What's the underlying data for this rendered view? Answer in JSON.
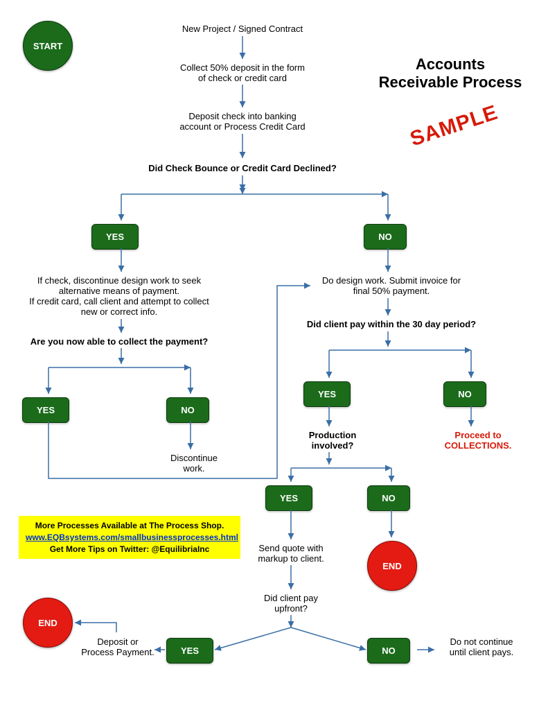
{
  "flowchart": {
    "start": "START",
    "end1": "END",
    "end2": "END",
    "title_line1": "Accounts",
    "title_line2": "Receivable Process",
    "sample": "SAMPLE",
    "steps": {
      "new_project": "New Project / Signed Contract",
      "collect_deposit_1": "Collect 50% deposit in the form",
      "collect_deposit_2": "of check or credit card",
      "deposit_check_1": "Deposit check into banking",
      "deposit_check_2": "account or Process Credit Card",
      "bounce_q": "Did Check Bounce or Credit Card Declined?",
      "if_check_1": "If check, discontinue design work to seek",
      "if_check_2": "alternative means of payment.",
      "if_check_3": "If credit card, call client and attempt to collect",
      "if_check_4": "new or correct info.",
      "collect_q": "Are you now able to collect the payment?",
      "discontinue": "Discontinue",
      "discontinue2": "work.",
      "design_work_1": "Do design work.  Submit invoice for",
      "design_work_2": "final 50% payment.",
      "pay30_q": "Did client pay within the 30 day period?",
      "production_q_1": "Production",
      "production_q_2": "involved?",
      "proceed_1": "Proceed to",
      "proceed_2": "COLLECTIONS.",
      "send_quote_1": "Send quote with",
      "send_quote_2": "markup to client.",
      "pay_upfront_1": "Did client pay",
      "pay_upfront_2": "upfront?",
      "deposit_or_1": "Deposit or",
      "deposit_or_2": "Process Payment.",
      "do_not_1": "Do not continue",
      "do_not_2": "until client pays."
    },
    "boxes": {
      "yes": "YES",
      "no": "NO"
    },
    "promo": {
      "line1": "More Processes Available at The Process Shop.",
      "link": "www.EQBsystems.com/smallbusinessprocesses.html",
      "line3": "Get More Tips on Twitter: @EquilibriaInc"
    }
  },
  "chart_data": {
    "type": "flowchart",
    "title": "Accounts Receivable Process",
    "nodes": [
      {
        "id": "start",
        "type": "terminator",
        "label": "START"
      },
      {
        "id": "n1",
        "type": "process",
        "label": "New Project / Signed Contract"
      },
      {
        "id": "n2",
        "type": "process",
        "label": "Collect 50% deposit in the form of check or credit card"
      },
      {
        "id": "n3",
        "type": "process",
        "label": "Deposit check into banking account or Process Credit Card"
      },
      {
        "id": "d1",
        "type": "decision",
        "label": "Did Check Bounce or Credit Card Declined?"
      },
      {
        "id": "n4",
        "type": "process",
        "label": "If check, discontinue design work to seek alternative means of payment. If credit card, call client and attempt to collect new or correct info."
      },
      {
        "id": "d2",
        "type": "decision",
        "label": "Are you now able to collect the payment?"
      },
      {
        "id": "n5",
        "type": "process",
        "label": "Discontinue work."
      },
      {
        "id": "n6",
        "type": "process",
        "label": "Do design work. Submit invoice for final 50% payment."
      },
      {
        "id": "d3",
        "type": "decision",
        "label": "Did client pay within the 30 day period?"
      },
      {
        "id": "n7",
        "type": "process",
        "label": "Proceed to COLLECTIONS."
      },
      {
        "id": "d4",
        "type": "decision",
        "label": "Production involved?"
      },
      {
        "id": "end1",
        "type": "terminator",
        "label": "END"
      },
      {
        "id": "n8",
        "type": "process",
        "label": "Send quote with markup to client."
      },
      {
        "id": "d5",
        "type": "decision",
        "label": "Did client pay upfront?"
      },
      {
        "id": "n9",
        "type": "process",
        "label": "Deposit or Process Payment."
      },
      {
        "id": "n10",
        "type": "process",
        "label": "Do not continue until client pays."
      },
      {
        "id": "end2",
        "type": "terminator",
        "label": "END"
      }
    ],
    "edges": [
      {
        "from": "n1",
        "to": "n2"
      },
      {
        "from": "n2",
        "to": "n3"
      },
      {
        "from": "n3",
        "to": "d1"
      },
      {
        "from": "d1",
        "to": "n4",
        "label": "YES"
      },
      {
        "from": "d1",
        "to": "n6",
        "label": "NO"
      },
      {
        "from": "n4",
        "to": "d2"
      },
      {
        "from": "d2",
        "to": "n6",
        "label": "YES"
      },
      {
        "from": "d2",
        "to": "n5",
        "label": "NO"
      },
      {
        "from": "n6",
        "to": "d3"
      },
      {
        "from": "d3",
        "to": "d4",
        "label": "YES"
      },
      {
        "from": "d3",
        "to": "n7",
        "label": "NO"
      },
      {
        "from": "d4",
        "to": "n8",
        "label": "YES"
      },
      {
        "from": "d4",
        "to": "end1",
        "label": "NO"
      },
      {
        "from": "n8",
        "to": "d5"
      },
      {
        "from": "d5",
        "to": "n9",
        "label": "YES"
      },
      {
        "from": "d5",
        "to": "n10",
        "label": "NO"
      },
      {
        "from": "n9",
        "to": "end2"
      }
    ]
  }
}
